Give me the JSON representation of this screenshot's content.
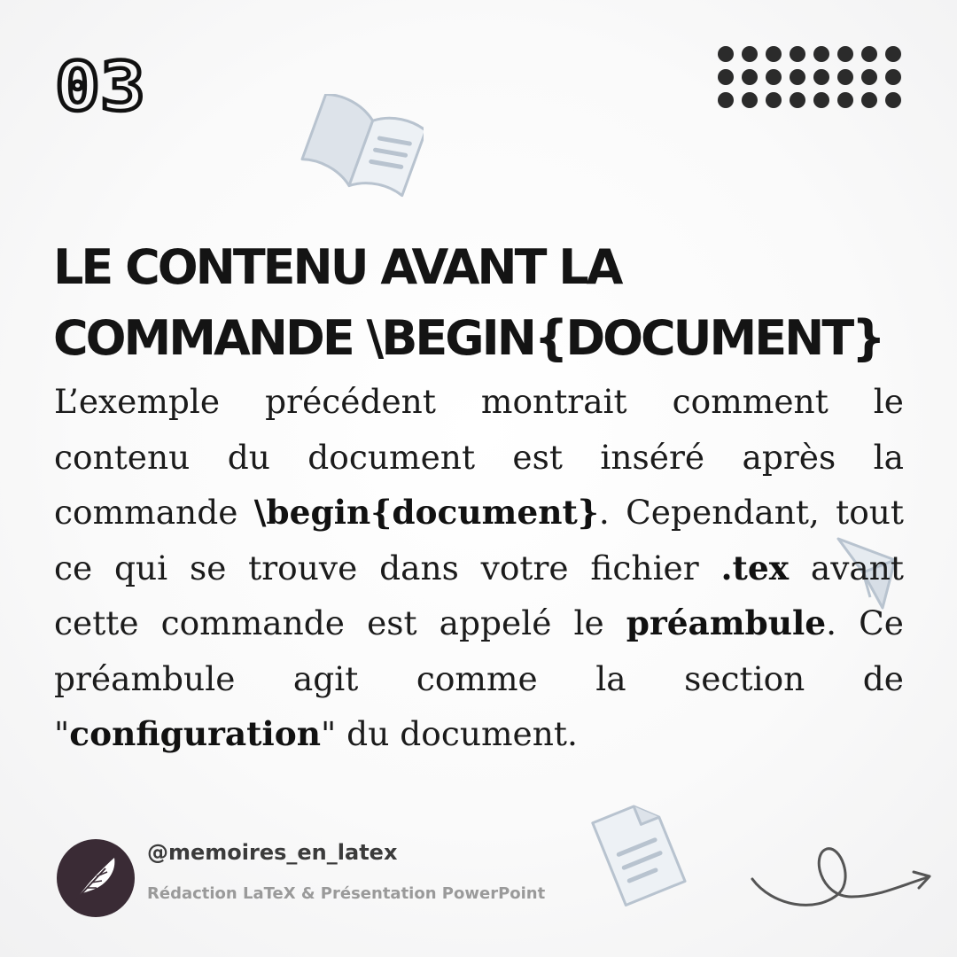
{
  "slide": {
    "number": "03"
  },
  "title": {
    "line1": "LE CONTENU AVANT LA",
    "line2": "COMMANDE \\BEGIN{DOCUMENT}"
  },
  "body": {
    "p1": "L’exemple précédent montrait comment le contenu du document est inséré après la commande ",
    "cmd": "\\begin{document}",
    "p2": ". Cependant, tout ce qui se trouve dans votre fichier ",
    "ext": ".tex",
    "p3": " avant cette commande est appelé le ",
    "term": "préambule",
    "p4": ". Ce préambule agit comme la section de \"",
    "config": "configuration",
    "p5": "\" du document."
  },
  "profile": {
    "handle": "@memoires_en_latex",
    "tagline": "Rédaction LaTeX & Présentation PowerPoint",
    "avatar_icon": "feather-quill-icon"
  },
  "decorations": {
    "dots": 24,
    "icons": [
      "open-book-icon",
      "paper-plane-icon",
      "document-icon",
      "swirl-arrow-icon"
    ]
  },
  "colors": {
    "text": "#141414",
    "avatar_bg": "#3a2b35",
    "deco_fill": "#dde3ea",
    "deco_stroke": "#b8c3cf"
  }
}
